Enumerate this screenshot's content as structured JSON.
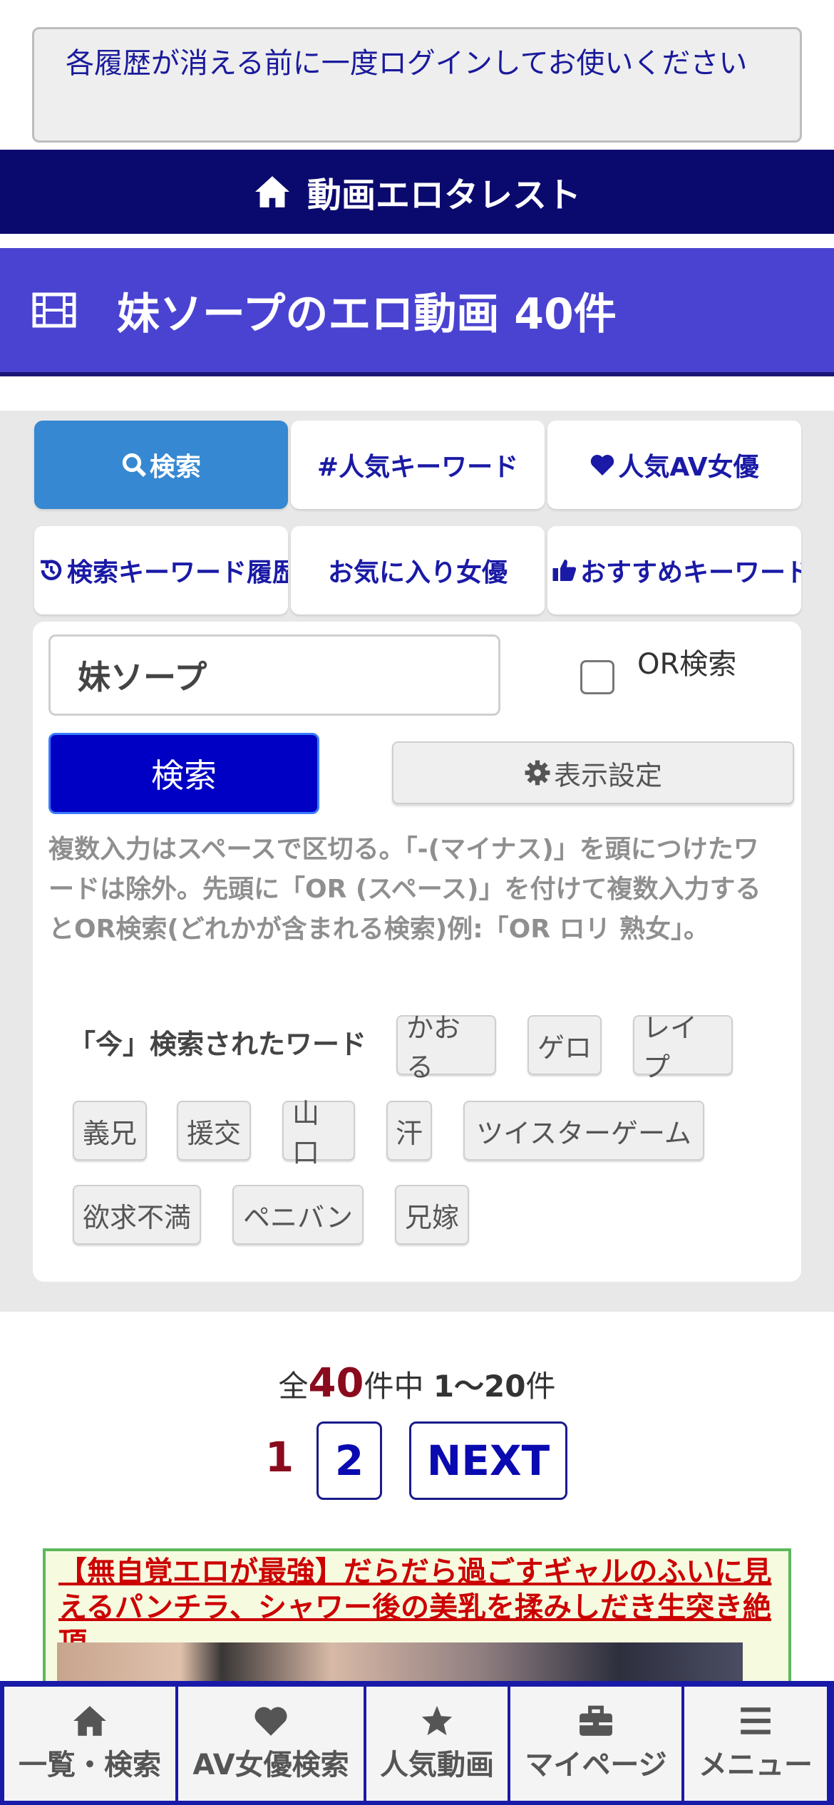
{
  "notice": {
    "text": "各履歴が消える前に一度ログインしてお使いください"
  },
  "header": {
    "site_name": "動画エロタレスト",
    "icon": "home-icon"
  },
  "page": {
    "title": "妹ソープのエロ動画 40件",
    "icon": "film-icon"
  },
  "tabs": [
    {
      "label": "検索",
      "icon": "search-icon",
      "active": true
    },
    {
      "label": "#人気キーワード",
      "icon": "",
      "active": false
    },
    {
      "label": "人気AV女優",
      "icon": "heart-icon",
      "active": false
    },
    {
      "label": "検索キーワード履歴",
      "icon": "history-icon",
      "active": false
    },
    {
      "label": "お気に入り女優",
      "icon": "",
      "active": false
    },
    {
      "label": "おすすめキーワード",
      "icon": "thumbs-up-icon",
      "active": false
    }
  ],
  "search": {
    "value": "妹ソープ",
    "or_label": "OR検索",
    "button_label": "検索",
    "display_settings_label": "表示設定",
    "help": "複数入力はスペースで区切る。「-(マイナス)」を頭につけたワードは除外。先頭に「OR (スペース)」を付けて複数入力するとOR検索(どれかが含まれる検索)例:「OR ロリ 熟女」。"
  },
  "trending": {
    "label": "「今」検索されたワード",
    "words": [
      "かおる",
      "ゲロ",
      "レイプ",
      "義兄",
      "援交",
      "山口",
      "汗",
      "ツイスターゲーム",
      "欲求不満",
      "ペニバン",
      "兄嫁"
    ]
  },
  "results": {
    "prefix": "全",
    "total": "40",
    "middle": "件中 ",
    "range": "1～20",
    "suffix": "件"
  },
  "pagination": {
    "current": "1",
    "page2": "2",
    "next": "NEXT"
  },
  "card": {
    "title": "【無自覚エロが最強】だらだら過ごすギャルのふいに見えるパンチラ、シャワー後の美乳を揉みしだき生突き絶頂"
  },
  "bottom_nav": [
    {
      "label": "一覧・検索",
      "icon": "home-icon"
    },
    {
      "label": "AV女優検索",
      "icon": "heart-icon"
    },
    {
      "label": "人気動画",
      "icon": "star-icon"
    },
    {
      "label": "マイページ",
      "icon": "briefcase-icon"
    },
    {
      "label": "メニュー",
      "icon": "menu-icon"
    }
  ],
  "colors": {
    "header_bg": "#0a0a6e",
    "title_bar_bg": "#4a43d1",
    "active_tab": "#3588d1",
    "search_button": "#0000c4",
    "total_count": "#8a0a1e",
    "card_title": "#cc0000",
    "nav_border": "#1a1aa8"
  }
}
